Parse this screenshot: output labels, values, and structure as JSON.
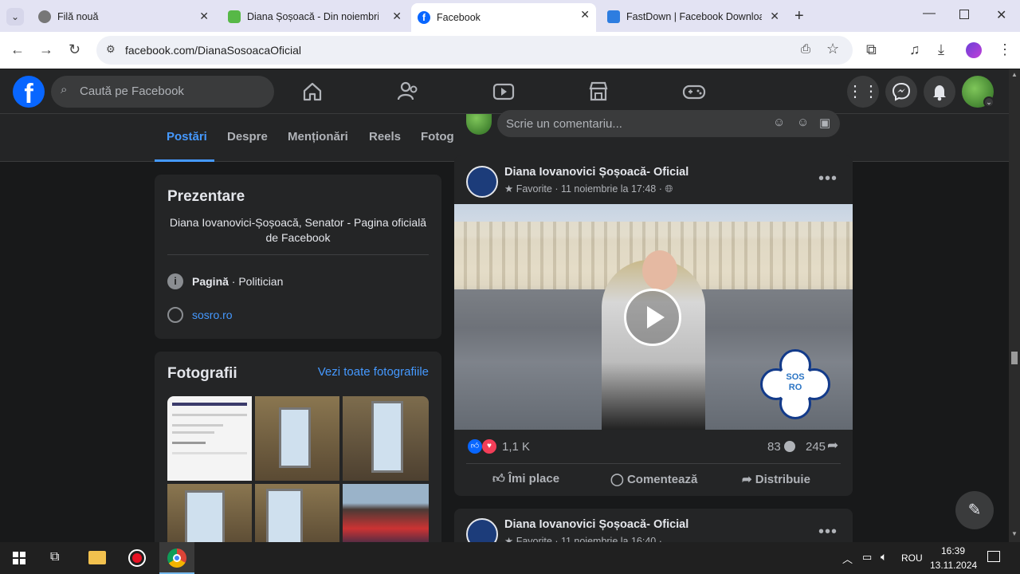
{
  "browser": {
    "tabs": [
      {
        "title": "Filă nouă"
      },
      {
        "title": "Diana Șoșoacă - Din noiembrie"
      },
      {
        "title": "Facebook"
      },
      {
        "title": "FastDown | Facebook Download"
      }
    ],
    "url": "facebook.com/DianaSosoacaOficial"
  },
  "fb": {
    "search_placeholder": "Caută pe Facebook",
    "profile_tabs": [
      "Postări",
      "Despre",
      "Menționări",
      "Reels",
      "Fotogr"
    ],
    "comment_placeholder": "Scrie un comentariu...",
    "intro": {
      "title": "Prezentare",
      "bio": "Diana Iovanovici-Șoșoacă, Senator - Pagina oficială de Facebook",
      "category_bold": "Pagină",
      "category_rest": " · Politician",
      "website": "sosro.ro"
    },
    "photos": {
      "title": "Fotografii",
      "see_all": "Vezi toate fotografiile"
    },
    "post": {
      "author": "Diana Iovanovici Șoșoacă- Oficial",
      "meta": "Favorite · 11 noiembrie la 17:48 ·",
      "reactions": "1,1 K",
      "comments": "83",
      "shares": "245",
      "like": "Îmi place",
      "comment": "Comentează",
      "share": "Distribuie",
      "logo_text": "SOS RO"
    },
    "post2": {
      "author": "Diana Iovanovici Șoșoacă- Oficial",
      "meta": "Favorite · 11 noiembrie la 16:40 ·"
    }
  },
  "taskbar": {
    "lang": "ROU",
    "time": "16:39",
    "date": "13.11.2024"
  }
}
